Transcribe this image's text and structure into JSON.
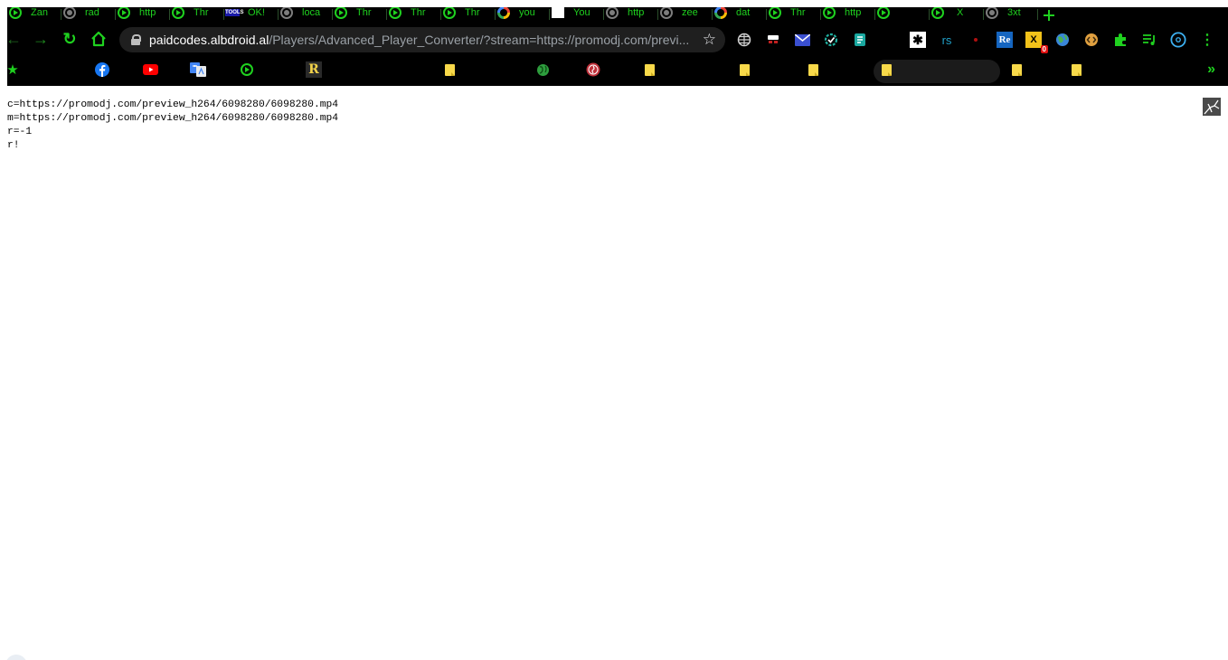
{
  "tabs": [
    {
      "icon": "play-icon",
      "title": "Zan"
    },
    {
      "icon": "grey-icon",
      "title": "rad"
    },
    {
      "icon": "play-icon",
      "title": "http"
    },
    {
      "icon": "play-icon",
      "title": "Thr"
    },
    {
      "icon": "tools-icon",
      "badge": "TOOLS",
      "title": "OK!"
    },
    {
      "icon": "grey-icon",
      "title": "loca"
    },
    {
      "icon": "play-icon",
      "title": "Thr"
    },
    {
      "icon": "play-icon",
      "title": "Thr"
    },
    {
      "icon": "play-icon",
      "title": "Thr"
    },
    {
      "icon": "google-icon",
      "title": "you"
    },
    {
      "icon": "white-icon",
      "title": "You"
    },
    {
      "icon": "grey-icon",
      "title": "http"
    },
    {
      "icon": "grey-icon",
      "title": "zee"
    },
    {
      "icon": "google-icon",
      "title": "dat"
    },
    {
      "icon": "play-icon",
      "title": "Thr"
    },
    {
      "icon": "play-icon",
      "title": "http"
    },
    {
      "icon": "play-icon",
      "title": ""
    },
    {
      "icon": "play-icon",
      "title": "X"
    },
    {
      "icon": "grey-icon",
      "title": "3xt"
    }
  ],
  "address_bar": {
    "host": "paidcodes.albdroid.al",
    "path": "/Players/Advanced_Player_Converter/?stream=https://promodj.com/previ..."
  },
  "extensions": {
    "rs_label": "rs",
    "re_label": "Re",
    "x_label": "X",
    "x_badge": "0",
    "asterisk_label": "✱"
  },
  "bookmarks": {
    "r_label": "R"
  },
  "page": {
    "lines": [
      "c=https://promodj.com/preview_h264/6098280/6098280.mp4",
      "m=https://promodj.com/preview_h264/6098280/6098280.mp4",
      "r=-1",
      "r!"
    ]
  },
  "colors": {
    "chrome_bg": "#000000",
    "accent_green": "#1fd11f",
    "omnibox_bg": "#1f1f1f"
  }
}
